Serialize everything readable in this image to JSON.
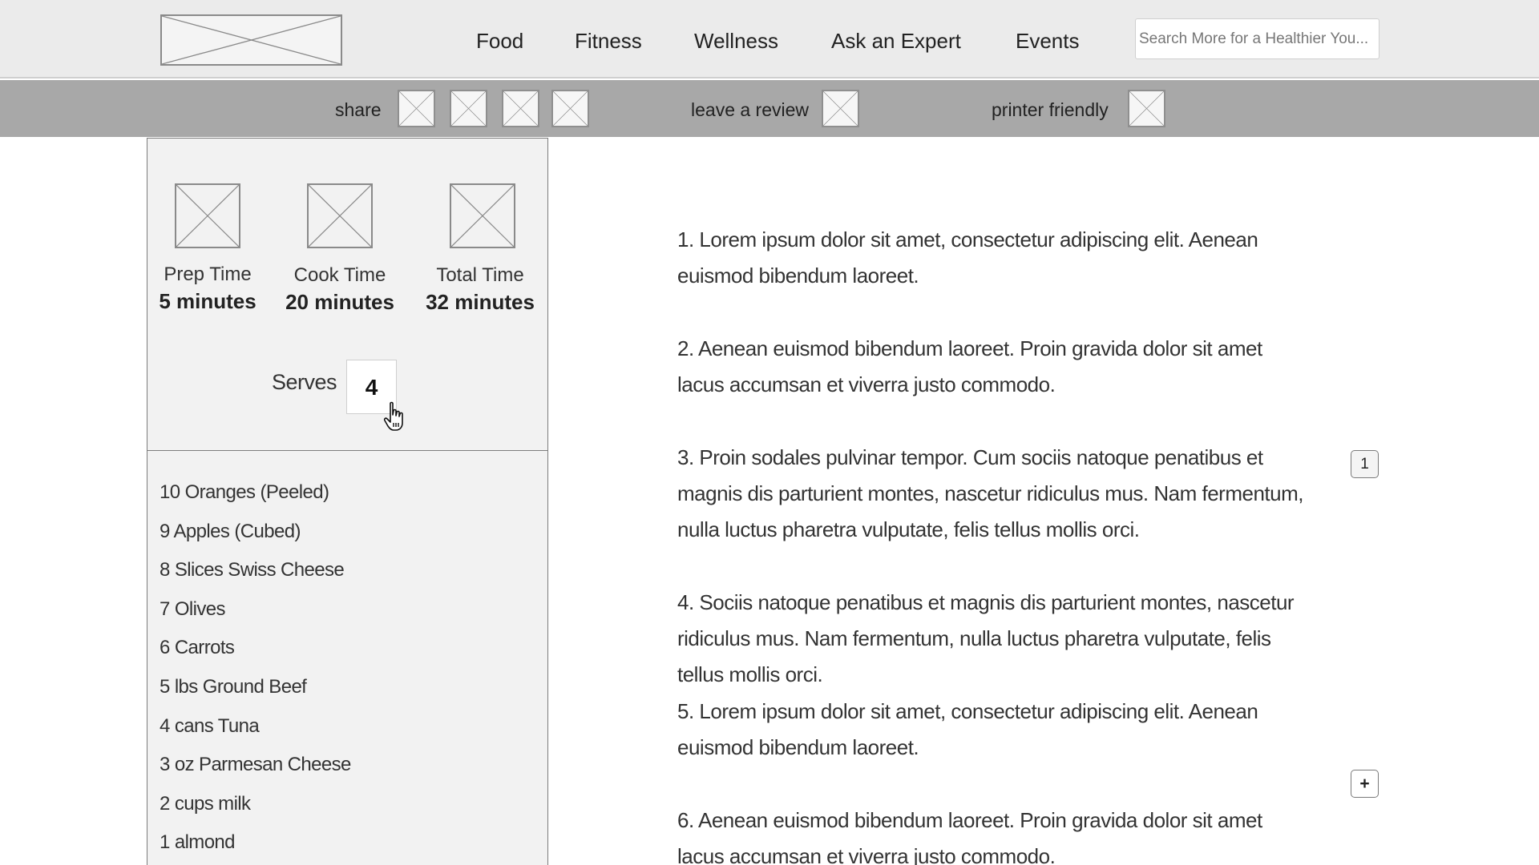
{
  "header": {
    "logo_icon": "image-placeholder-icon",
    "nav": [
      "Food",
      "Fitness",
      "Wellness",
      "Ask an Expert",
      "Events"
    ],
    "search": {
      "placeholder": "Search More for a Healthier You...",
      "value": ""
    }
  },
  "sharebar": {
    "share_label": "share",
    "share_icons": [
      "image-placeholder-icon",
      "image-placeholder-icon",
      "image-placeholder-icon",
      "image-placeholder-icon"
    ],
    "review_label": "leave a review",
    "printer_label": "printer friendly"
  },
  "recipe": {
    "times": [
      {
        "label": "Prep Time",
        "value": "5 minutes"
      },
      {
        "label": "Cook Time",
        "value": "20 minutes"
      },
      {
        "label": "Total Time",
        "value": "32 minutes"
      }
    ],
    "serves_label": "Serves",
    "serves_value": "4",
    "ingredients": [
      "10 Oranges (Peeled)",
      "9 Apples (Cubed)",
      "8 Slices Swiss Cheese",
      "7 Olives",
      "6 Carrots",
      "5 lbs Ground Beef",
      "4 cans Tuna",
      "3 oz Parmesan Cheese",
      "2 cups milk",
      "1 almond"
    ],
    "steps": [
      "1. Lorem ipsum dolor sit amet, consectetur adipiscing elit. Aenean euismod bibendum laoreet.",
      "2. Aenean euismod bibendum laoreet. Proin gravida dolor sit amet lacus accumsan et viverra justo commodo.",
      "3. Proin sodales pulvinar tempor. Cum sociis natoque penatibus et magnis dis parturient montes, nascetur ridiculus mus. Nam fermentum, nulla luctus pharetra vulputate, felis tellus mollis orci.",
      "4. Sociis natoque penatibus et magnis dis parturient montes, nascetur ridiculus mus. Nam fermentum, nulla luctus pharetra vulputate, felis tellus mollis orci.",
      "5. Lorem ipsum dolor sit amet, consectetur adipiscing elit. Aenean euismod bibendum laoreet.",
      "6. Aenean euismod bibendum laoreet. Proin gravida dolor sit amet lacus accumsan et viverra justo commodo."
    ],
    "comment_badge": "1",
    "add_badge": "+"
  },
  "colors": {
    "header_bg": "#ebebeb",
    "sharebar_bg": "#a8a8a8",
    "panel_bg": "#f2f2f2",
    "placeholder_stroke": "#8a8a8a"
  }
}
